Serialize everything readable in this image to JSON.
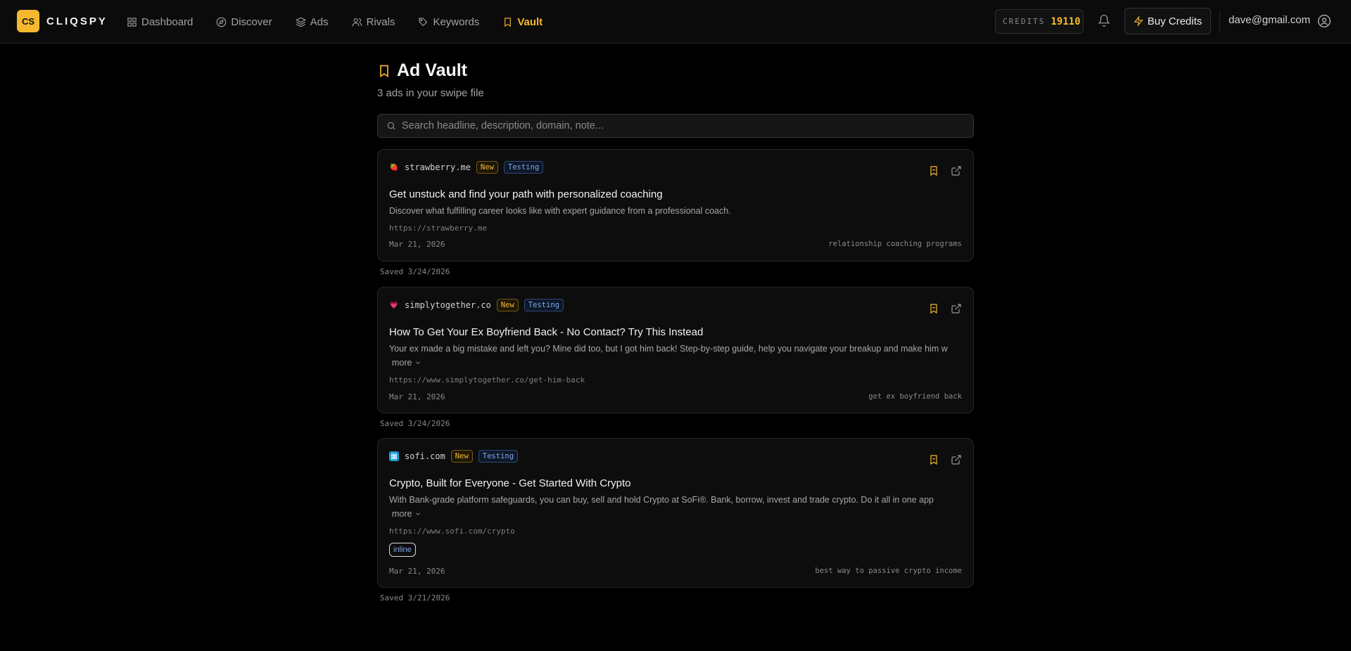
{
  "brand": {
    "badge": "CS",
    "name": "CLIQSPY",
    "accent": "#f5b82e"
  },
  "nav": [
    {
      "label": "Dashboard",
      "icon": "dashboard-icon"
    },
    {
      "label": "Discover",
      "icon": "compass-icon"
    },
    {
      "label": "Ads",
      "icon": "layers-icon"
    },
    {
      "label": "Rivals",
      "icon": "users-icon"
    },
    {
      "label": "Keywords",
      "icon": "tag-icon"
    },
    {
      "label": "Vault",
      "icon": "bookmark-icon",
      "active": true
    }
  ],
  "header": {
    "credits_label": "CREDITS",
    "credits_value": "19110",
    "buy_label": "Buy Credits",
    "email": "dave@gmail.com"
  },
  "page": {
    "title": "Ad Vault",
    "subtitle": "3 ads in your swipe file",
    "search_placeholder": "Search headline, description, domain, note..."
  },
  "ads": [
    {
      "domain": "strawberry.me",
      "favicon": "🍓",
      "badge_new": "New",
      "badge_status": "Testing",
      "headline": "Get unstuck and find your path with personalized coaching",
      "description": "Discover what fulfilling career looks like with expert guidance from a professional coach.",
      "url": "https://strawberry.me",
      "date": "Mar 21, 2026",
      "keyword": "relationship coaching programs",
      "saved": "Saved 3/24/2026"
    },
    {
      "domain": "simplytogether.co",
      "favicon": "💗",
      "badge_new": "New",
      "badge_status": "Testing",
      "headline": "How To Get Your Ex Boyfriend Back - No Contact? Try This Instead",
      "description": "Your ex made a big mistake and left you? Mine did too, but I got him back! Step-by-step guide, help you navigate your breakup and make him w",
      "more": "more",
      "url": "https://www.simplytogether.co/get-him-back",
      "date": "Mar 21, 2026",
      "keyword": "get ex boyfriend back",
      "saved": "Saved 3/24/2026"
    },
    {
      "domain": "sofi.com",
      "favicon": "▦",
      "badge_new": "New",
      "badge_status": "Testing",
      "headline": "Crypto, Built for Everyone - Get Started With Crypto",
      "description": "With Bank-grade platform safeguards, you can buy, sell and hold Crypto at SoFi®. Bank, borrow, invest and trade crypto. Do it all in one app",
      "more": "more",
      "url": "https://www.sofi.com/crypto",
      "tag": "inline",
      "date": "Mar 21, 2026",
      "keyword": "best way to passive crypto income",
      "saved": "Saved 3/21/2026"
    }
  ]
}
